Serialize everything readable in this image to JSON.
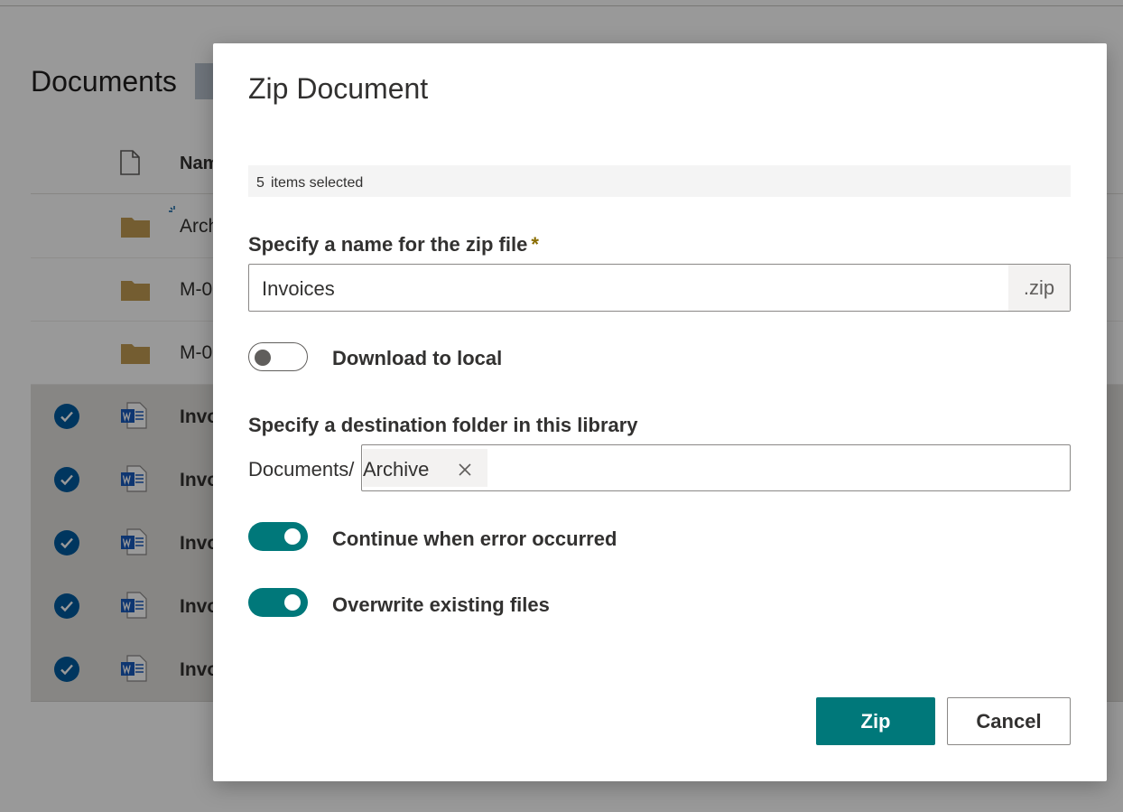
{
  "background": {
    "library_title": "Documents",
    "name_column": "Nam",
    "rows": [
      {
        "name": "Arch",
        "type": "folder",
        "selected": false
      },
      {
        "name": "M-0",
        "type": "folder",
        "selected": false
      },
      {
        "name": "M-0",
        "type": "folder",
        "selected": false
      },
      {
        "name": "Invo",
        "type": "word",
        "selected": true
      },
      {
        "name": "Invo",
        "type": "word",
        "selected": true
      },
      {
        "name": "Invo",
        "type": "word",
        "selected": true
      },
      {
        "name": "Invo",
        "type": "word",
        "selected": true
      },
      {
        "name": "Invo",
        "type": "word",
        "selected": true
      }
    ]
  },
  "dialog": {
    "title": "Zip Document",
    "selected_count": "5",
    "selected_text": "items selected",
    "zip_name": {
      "label": "Specify a name for the zip file",
      "required_marker": "*",
      "value": "Invoices",
      "suffix": ".zip"
    },
    "download_to_local": {
      "label": "Download to local",
      "on": false
    },
    "destination": {
      "label": "Specify a destination folder in this library",
      "prefix": "Documents/",
      "chip": "Archive"
    },
    "continue_on_error": {
      "label": "Continue when error occurred",
      "on": true
    },
    "overwrite_existing": {
      "label": "Overwrite existing files",
      "on": true
    },
    "buttons": {
      "primary": "Zip",
      "secondary": "Cancel"
    }
  },
  "colors": {
    "accent": "#00787a",
    "folder": "#c19c52",
    "check": "#005a9e",
    "word": "#185abd"
  }
}
